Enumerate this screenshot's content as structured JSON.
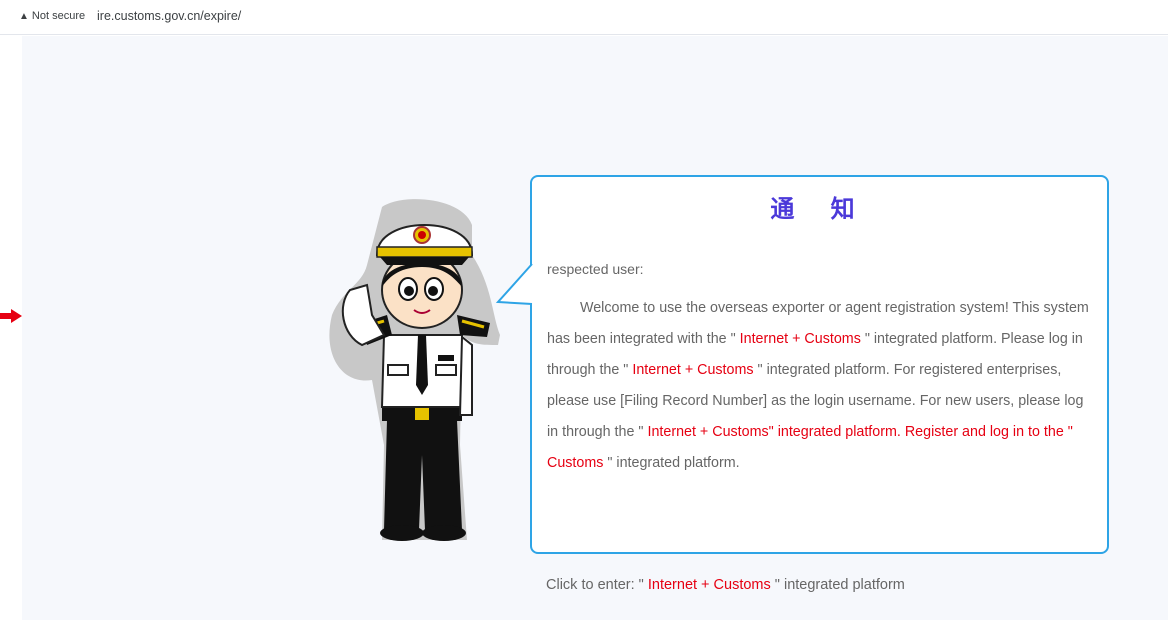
{
  "browser": {
    "security_label": "Not secure",
    "url": "ire.customs.gov.cn/expire/"
  },
  "notice": {
    "title": "通 知",
    "greeting": "respected user:",
    "paragraph": {
      "s1": "Welcome to use the overseas exporter or agent registration system! This system has been integrated with the \" ",
      "s2": "Internet + Customs",
      "s3": " \" integrated platform. Please log in through the \" ",
      "s4": "Internet + Customs",
      "s5": " \" integrated platform. For registered enterprises, please use [Filing Record Number] as the login username. For new users, please log in through the \" ",
      "s6": "Internet + Customs\" integrated platform. Register and log in to the \" Customs",
      "s7": " \" integrated platform."
    }
  },
  "footer": {
    "prefix": "Click to enter: \" ",
    "link": "Internet + Customs",
    "suffix": " \" integrated platform"
  },
  "colors": {
    "accent_blue": "#2ea4e6",
    "title_purple": "#4b39d9",
    "link_red": "#e60012",
    "body_text": "#666666",
    "page_bg": "#f6f8fc"
  },
  "icons": [
    "red-arrow-icon",
    "customs-officer-mascot"
  ]
}
